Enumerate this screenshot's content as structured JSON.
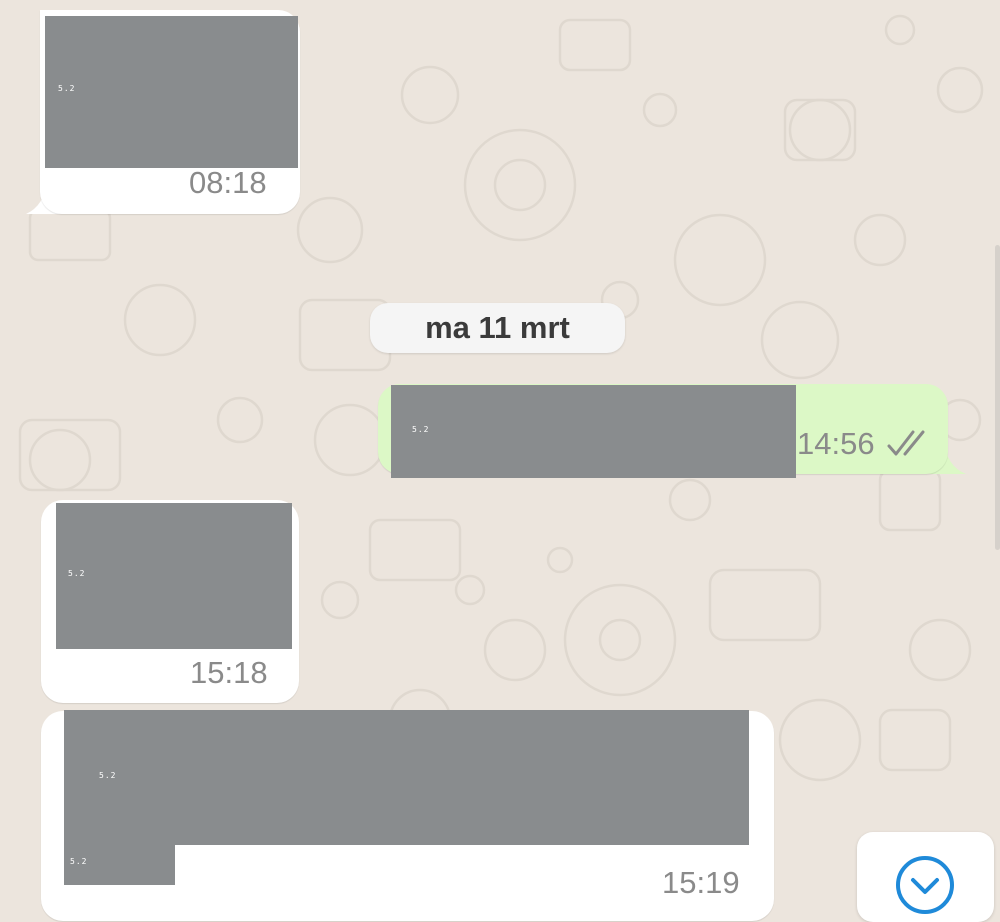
{
  "chat": {
    "date_separator": "ma 11 mrt",
    "messages": [
      {
        "direction": "incoming",
        "time": "08:18",
        "redacted_tags": [
          "5.2"
        ]
      },
      {
        "direction": "outgoing",
        "time": "14:56",
        "status_icon": "double-check-icon",
        "redacted_tags": [
          "5.2"
        ]
      },
      {
        "direction": "incoming",
        "time": "15:18",
        "redacted_tags": [
          "5.2"
        ]
      },
      {
        "direction": "incoming",
        "time": "15:19",
        "redacted_tags": [
          "5.2",
          "5.2"
        ]
      }
    ]
  },
  "controls": {
    "scroll_down_icon": "chevron-down-circle-icon"
  },
  "colors": {
    "chat_background": "#ece5dd",
    "incoming_bubble": "#ffffff",
    "outgoing_bubble": "#dcf8c6",
    "redaction": "#898c8e",
    "accent": "#1f8ad9"
  }
}
